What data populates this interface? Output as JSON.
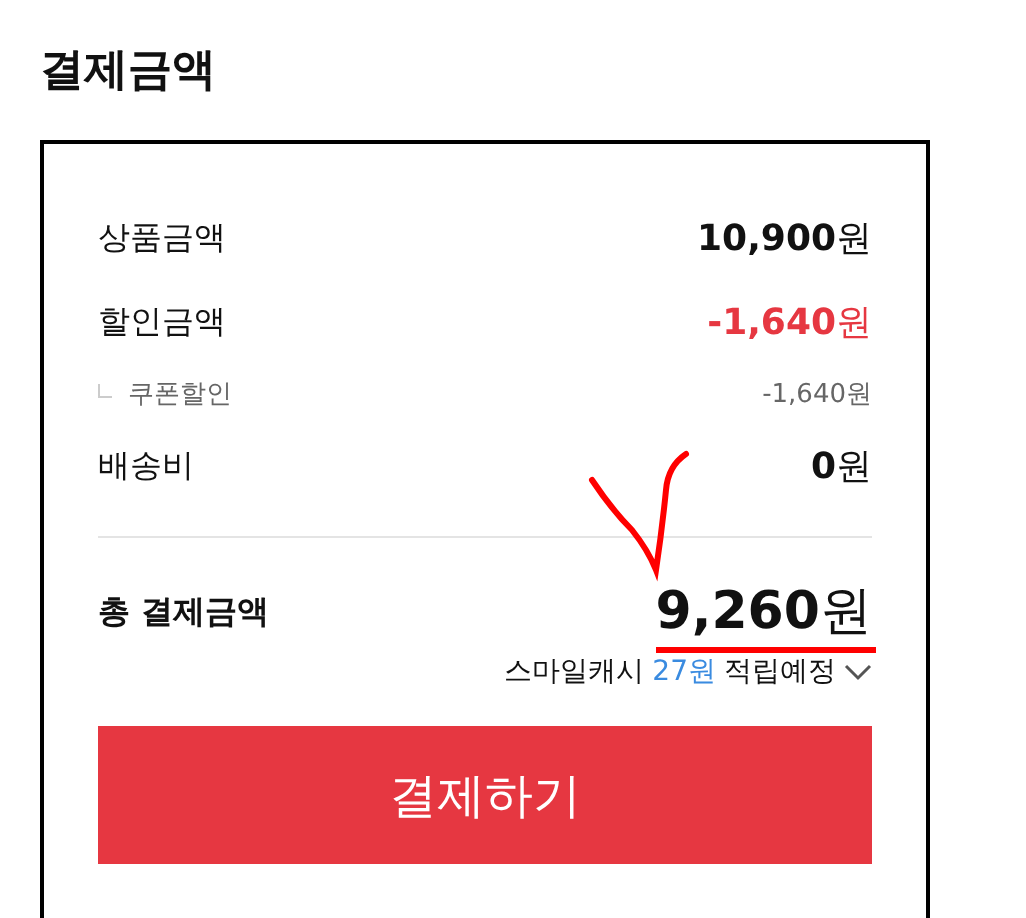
{
  "title": "결제금액",
  "rows": [
    {
      "kind": "main",
      "label": "상품금액",
      "amount": "**10,900**원",
      "discount": false
    },
    {
      "kind": "main",
      "label": "할인금액",
      "amount": "**-1,640**원",
      "discount": true
    },
    {
      "kind": "sub",
      "label": "쿠폰할인",
      "amount": "-1,640원",
      "discount": false
    },
    {
      "kind": "main",
      "label": "배송비",
      "amount": "**0**원",
      "discount": false
    }
  ],
  "total": {
    "label": "총 결제금액",
    "amount": "**9,260**원"
  },
  "cashback": {
    "label": "스마일캐시",
    "amount": "27원",
    "suffix": "적립예정"
  },
  "pay_button": "결제하기",
  "annotations": {
    "check_mark": true,
    "underline": true
  }
}
